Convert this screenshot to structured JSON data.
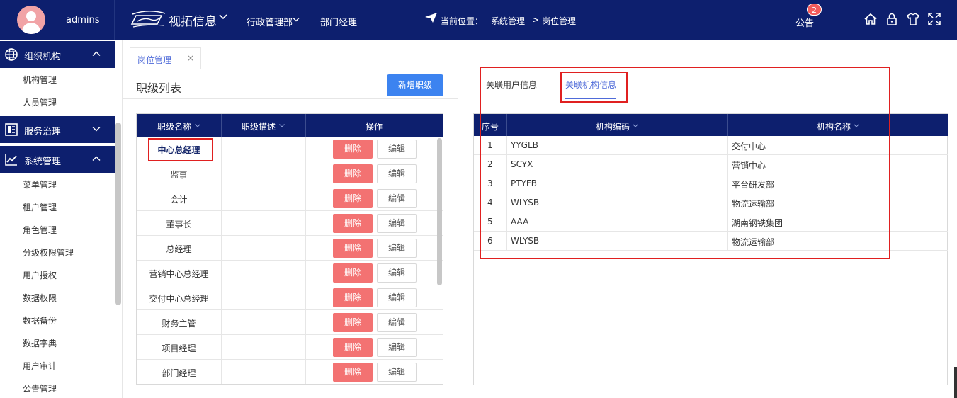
{
  "user": {
    "name": "admins"
  },
  "header": {
    "brand": "视拓信息",
    "nav": [
      "行政管理部",
      "部门经理"
    ],
    "location_label": "当前位置：",
    "breadcrumb": [
      "系统管理",
      "岗位管理"
    ],
    "breadcrumb_sep": ">",
    "notice_label": "公告",
    "notice_count": "2",
    "tools": [
      "home-icon",
      "lock-icon",
      "shirt-icon",
      "fullscreen-icon"
    ]
  },
  "sidebar": {
    "groups": [
      {
        "label": "组织机构",
        "icon": "globe-icon",
        "expanded": true,
        "items": [
          "机构管理",
          "人员管理"
        ]
      },
      {
        "label": "服务治理",
        "icon": "server-icon",
        "expanded": false,
        "items": []
      },
      {
        "label": "系统管理",
        "icon": "chart-icon",
        "expanded": true,
        "items": [
          "菜单管理",
          "租户管理",
          "角色管理",
          "分级权限管理",
          "用户授权",
          "数据权限",
          "数据备份",
          "数据字典",
          "用户审计",
          "公告管理"
        ]
      }
    ]
  },
  "tabs": [
    {
      "label": "岗位管理",
      "close": "×"
    }
  ],
  "left_panel": {
    "title": "职级列表",
    "add_button": "新增职级",
    "columns": [
      "职级名称",
      "职级描述",
      "操作"
    ],
    "rows": [
      "中心总经理",
      "监事",
      "会计",
      "董事长",
      "总经理",
      "营销中心总经理",
      "交付中心总经理",
      "财务主管",
      "项目经理",
      "部门经理"
    ],
    "delete_label": "删除",
    "edit_label": "编辑"
  },
  "right_panel": {
    "tabs": [
      "关联用户信息",
      "关联机构信息"
    ],
    "active_tab": 1,
    "columns": [
      "序号",
      "机构编码",
      "机构名称"
    ],
    "rows": [
      {
        "no": "1",
        "code": "YYGLB",
        "name": "交付中心"
      },
      {
        "no": "2",
        "code": "SCYX",
        "name": "营销中心"
      },
      {
        "no": "3",
        "code": "PTYFB",
        "name": "平台研发部"
      },
      {
        "no": "4",
        "code": "WLYSB",
        "name": "物流运输部"
      },
      {
        "no": "5",
        "code": "AAA",
        "name": "湖南钢铁集团"
      },
      {
        "no": "6",
        "code": "WLYSB",
        "name": "物流运输部"
      }
    ]
  },
  "colors": {
    "nav_bg": "#0d1f6e",
    "primary": "#3c83f0",
    "danger": "#f37272",
    "active_tab": "#4f6bd9",
    "highlight": "#e02020"
  }
}
